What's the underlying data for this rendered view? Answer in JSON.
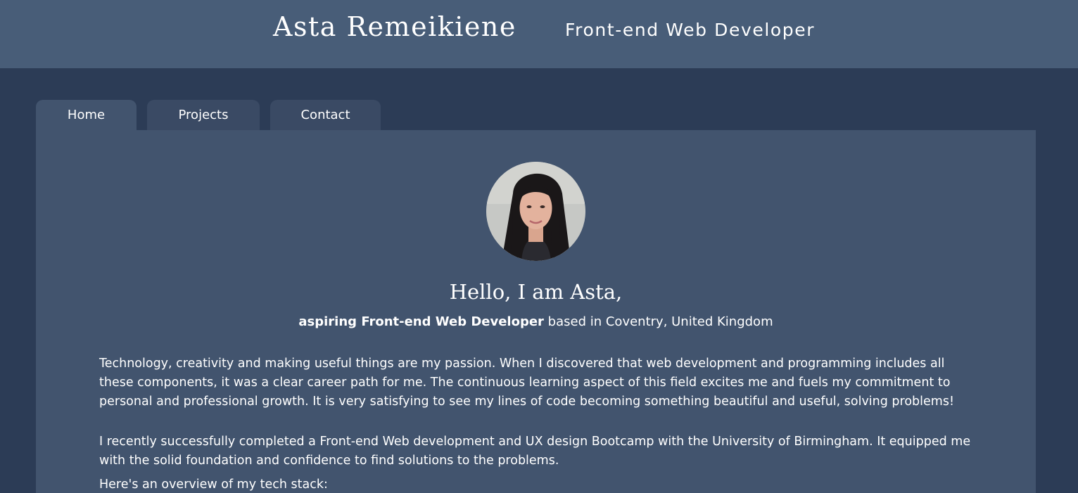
{
  "header": {
    "name": "Asta Remeikiene",
    "role": "Front-end Web Developer"
  },
  "tabs": [
    {
      "label": "Home",
      "active": true
    },
    {
      "label": "Projects",
      "active": false
    },
    {
      "label": "Contact",
      "active": false
    }
  ],
  "profile": {
    "photo_alt": "Profile photo",
    "greeting": "Hello, I am Asta,",
    "subtitle_strong": "aspiring Front-end Web Developer",
    "subtitle_rest": " based in Coventry, United Kingdom"
  },
  "about": {
    "paragraph_1": "Technology, creativity and making useful things are my passion. When I discovered that web development and programming includes all these components, it was a clear career path for me. The continuous learning aspect of this field excites me and fuels my commitment to personal and professional growth. It is very satisfying to see my lines of code becoming something beautiful and useful, solving problems!",
    "paragraph_2": "I recently successfully completed a Front-end Web development and UX design Bootcamp with the University of Birmingham. It equipped me with the solid foundation and confidence to find solutions to the problems.",
    "tech_stack_intro": "Here's an overview of my tech stack:"
  },
  "colors": {
    "header_bg": "#485d78",
    "page_bg": "#2c3c56",
    "panel_bg": "#42546e",
    "tab_bg": "#3a4a64"
  }
}
